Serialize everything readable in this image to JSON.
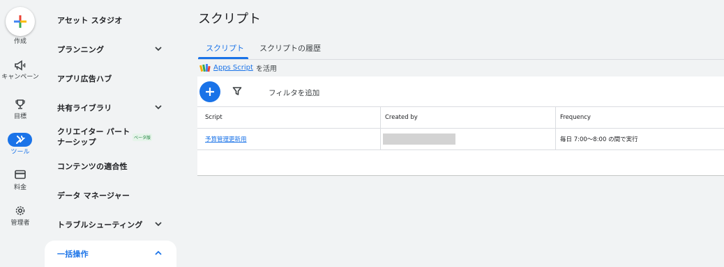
{
  "rail": {
    "create_label": "作成",
    "items": [
      {
        "label": "キャンペーン",
        "icon": "megaphone-icon"
      },
      {
        "label": "目標",
        "icon": "trophy-icon"
      },
      {
        "label": "ツール",
        "icon": "tools-icon",
        "active": true
      },
      {
        "label": "料金",
        "icon": "credit-card-icon"
      },
      {
        "label": "管理者",
        "icon": "gear-icon"
      }
    ]
  },
  "nav": {
    "items": [
      {
        "label": "アセット スタジオ"
      },
      {
        "label": "プランニング",
        "chevron": "down"
      },
      {
        "label": "アプリ広告ハブ"
      },
      {
        "label": "共有ライブラリ",
        "chevron": "down"
      },
      {
        "label_line1": "クリエイター パート",
        "label_line2": "ナーシップ",
        "badge": "ベータ版"
      },
      {
        "label": "コンテンツの適合性"
      },
      {
        "label": "データ マネージャー"
      },
      {
        "label": "トラブルシューティング",
        "chevron": "down"
      },
      {
        "label": "一括操作",
        "chevron": "up",
        "expanded": true
      }
    ]
  },
  "main": {
    "title": "スクリプト",
    "tabs": [
      {
        "label": "スクリプト",
        "active": true
      },
      {
        "label": "スクリプトの履歴"
      }
    ],
    "apps_script": {
      "link": "Apps Script",
      "suffix": "を活用"
    },
    "filter_label": "フィルタを追加",
    "table": {
      "headers": [
        "Script",
        "Created by",
        "Frequency"
      ],
      "rows": [
        {
          "script": "予算管理更新用",
          "created_by": "",
          "frequency": "毎日 7:00～8:00 の間で実行"
        }
      ]
    }
  },
  "colors": {
    "accent": "#1a73e8",
    "background": "#f1f3f4"
  }
}
